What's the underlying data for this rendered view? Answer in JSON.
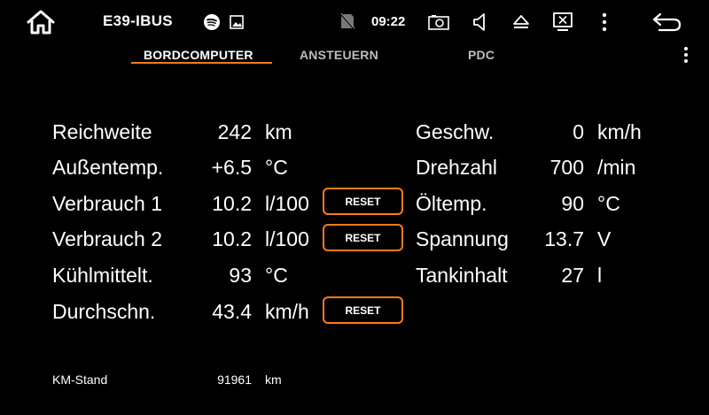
{
  "status_bar": {
    "app_title": "E39-IBUS",
    "time": "09:22"
  },
  "tabs": [
    {
      "label": "BORDCOMPUTER",
      "active": true
    },
    {
      "label": "ANSTEUERN",
      "active": false
    },
    {
      "label": "PDC",
      "active": false
    }
  ],
  "left": [
    {
      "label": "Reichweite",
      "value": "242",
      "unit": "km"
    },
    {
      "label": "Außentemp.",
      "value": "+6.5",
      "unit": "°C"
    },
    {
      "label": "Verbrauch 1",
      "value": "10.2",
      "unit": "l/100",
      "reset": "RESET"
    },
    {
      "label": "Verbrauch 2",
      "value": "10.2",
      "unit": "l/100",
      "reset": "RESET"
    },
    {
      "label": "Kühlmittelt.",
      "value": "93",
      "unit": "°C"
    },
    {
      "label": "Durchschn.",
      "value": "43.4",
      "unit": "km/h",
      "reset": "RESET"
    }
  ],
  "right": [
    {
      "label": "Geschw.",
      "value": "0",
      "unit": "km/h"
    },
    {
      "label": "Drehzahl",
      "value": "700",
      "unit": "/min"
    },
    {
      "label": "Öltemp.",
      "value": "90",
      "unit": "°C"
    },
    {
      "label": "Spannung",
      "value": "13.7",
      "unit": "V"
    },
    {
      "label": "Tankinhalt",
      "value": "27",
      "unit": "l"
    }
  ],
  "odometer": {
    "label": "KM-Stand",
    "value": "91961",
    "unit": "km"
  },
  "icons": {
    "home": "home-icon",
    "spotify": "spotify-icon",
    "image": "image-icon",
    "sim": "no-sim-icon",
    "camera": "camera-icon",
    "volume": "volume-icon",
    "eject": "eject-icon",
    "screen_off": "screen-off-icon",
    "menu": "more-vertical-icon",
    "back": "back-icon"
  },
  "colors": {
    "accent": "#ff7a1a",
    "background": "#000000",
    "text": "#ffffff"
  }
}
